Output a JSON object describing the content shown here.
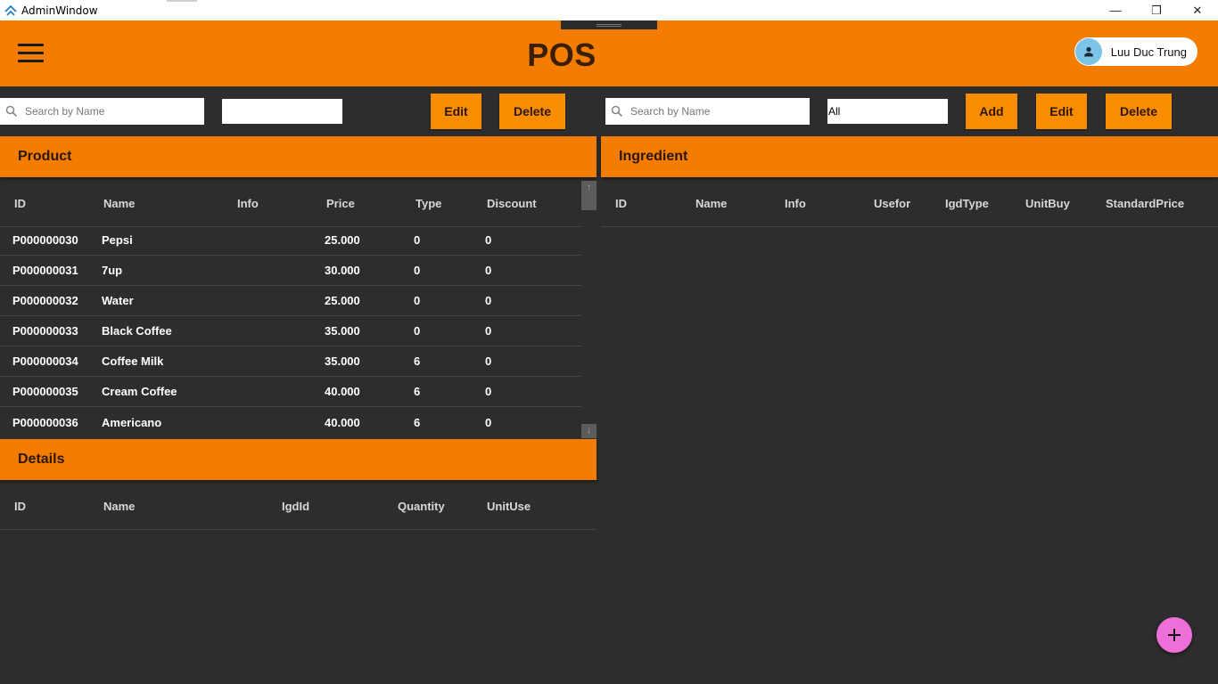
{
  "window": {
    "title": "AdminWindow",
    "minimize_glyph": "—",
    "restore_glyph": "❐",
    "close_glyph": "✕"
  },
  "header": {
    "title": "POS",
    "user_name": "Luu Duc Trung",
    "menu_icon": "hamburger-icon",
    "avatar_icon": "person-icon",
    "accent_color": "#f47c00"
  },
  "product_toolbar": {
    "search_placeholder": "Search by Name",
    "filter_value": "",
    "edit_label": "Edit",
    "delete_label": "Delete"
  },
  "ingredient_toolbar": {
    "search_placeholder": "Search by Name",
    "filter_value": "All",
    "add_label": "Add",
    "edit_label": "Edit",
    "delete_label": "Delete"
  },
  "product": {
    "title": "Product",
    "columns": [
      "ID",
      "Name",
      "Info",
      "Price",
      "Type",
      "Discount"
    ],
    "rows": [
      {
        "id": "P000000030",
        "name": "Pepsi",
        "info": "",
        "price": "25.000",
        "type": "0",
        "discount": "0"
      },
      {
        "id": "P000000031",
        "name": "7up",
        "info": "",
        "price": "30.000",
        "type": "0",
        "discount": "0"
      },
      {
        "id": "P000000032",
        "name": "Water",
        "info": "",
        "price": "25.000",
        "type": "0",
        "discount": "0"
      },
      {
        "id": "P000000033",
        "name": "Black Coffee",
        "info": "",
        "price": "35.000",
        "type": "0",
        "discount": "0"
      },
      {
        "id": "P000000034",
        "name": "Coffee Milk",
        "info": "",
        "price": "35.000",
        "type": "6",
        "discount": "0"
      },
      {
        "id": "P000000035",
        "name": "Cream Coffee",
        "info": "",
        "price": "40.000",
        "type": "6",
        "discount": "0"
      },
      {
        "id": "P000000036",
        "name": "Americano",
        "info": "",
        "price": "40.000",
        "type": "6",
        "discount": "0"
      }
    ]
  },
  "ingredient": {
    "title": "Ingredient",
    "columns": [
      "ID",
      "Name",
      "Info",
      "Usefor",
      "IgdType",
      "UnitBuy",
      "StandardPrice"
    ]
  },
  "details": {
    "title": "Details",
    "columns": [
      "ID",
      "Name",
      "IgdId",
      "Quantity",
      "UnitUse"
    ]
  },
  "fab": {
    "icon": "plus-icon",
    "color": "#ee6fd8"
  }
}
